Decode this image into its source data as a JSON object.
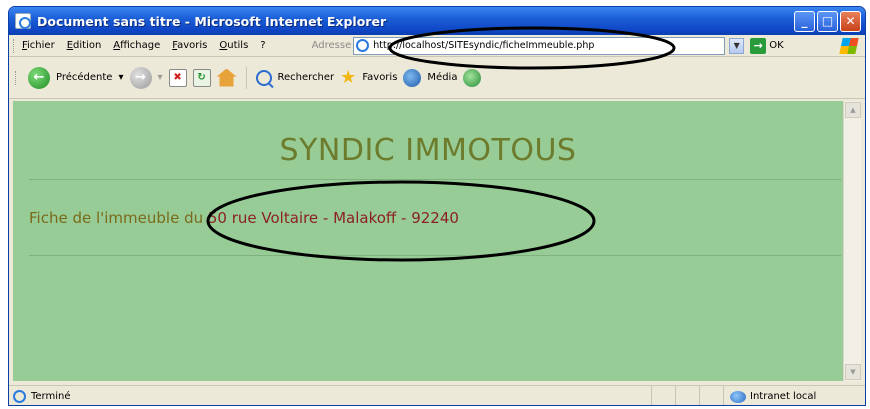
{
  "window": {
    "title": "Document sans titre - Microsoft Internet Explorer",
    "controls": {
      "minimize": "_",
      "maximize": "□",
      "close": "✕"
    }
  },
  "menu": {
    "items": [
      "Fichier",
      "Edition",
      "Affichage",
      "Favoris",
      "Outils",
      "?"
    ]
  },
  "address_bar": {
    "label": "Adresse",
    "url": "http://localhost/SITEsyndic/ficheImmeuble.php",
    "go_label": "OK",
    "go_arrow": "→",
    "dropdown_arrow": "▼"
  },
  "toolbar": {
    "back_label": "Précédente",
    "back_dropdown": "▾",
    "forward_dropdown": "▾",
    "search_label": "Rechercher",
    "favorites_label": "Favoris",
    "media_label": "Média"
  },
  "page": {
    "site_title": "SYNDIC IMMOTOUS",
    "fiche_label": "Fiche de l'immeuble du ",
    "fiche_address": "50 rue Voltaire - Malakoff - 92240"
  },
  "status": {
    "text": "Terminé",
    "zone": "Intranet local"
  },
  "scrollbar": {
    "up_arrow": "▲",
    "down_arrow": "▼"
  },
  "colors": {
    "page_background": "#97cc97",
    "title_color": "#6c7c2c",
    "label_color": "#7a6a1a",
    "address_color": "#8c1f1f",
    "titlebar_blue": "#1c5fd8"
  },
  "icons": [
    "ie-icon",
    "back-icon",
    "forward-icon",
    "stop-icon",
    "refresh-icon",
    "home-icon",
    "search-icon",
    "favorites-star-icon",
    "media-icon",
    "history-icon",
    "windows-logo-icon",
    "intranet-zone-icon"
  ]
}
